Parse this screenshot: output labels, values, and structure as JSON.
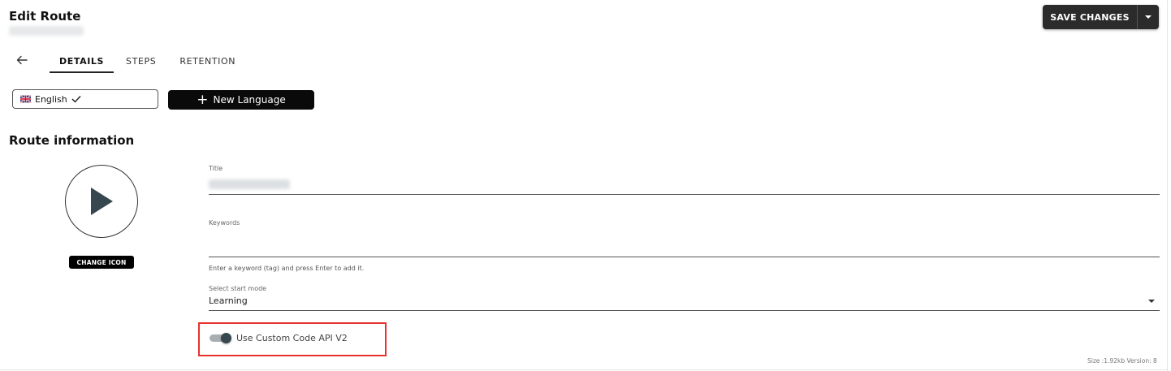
{
  "header": {
    "title": "Edit Route",
    "save_label": "SAVE CHANGES",
    "save_dropdown_icon": "caret-down-icon"
  },
  "nav": {
    "back_icon": "arrow-left-icon",
    "tabs": [
      {
        "label": "DETAILS",
        "active": true
      },
      {
        "label": "STEPS",
        "active": false
      },
      {
        "label": "RETENTION",
        "active": false
      }
    ]
  },
  "languages": {
    "current": "English",
    "current_flag_icon": "uk-flag-icon",
    "current_check_icon": "check-icon",
    "new_label": "New Language",
    "new_icon": "plus-icon"
  },
  "route_info": {
    "section_title": "Route information",
    "icon": "play-icon",
    "change_icon_label": "CHANGE ICON",
    "title_label": "Title",
    "keywords_label": "Keywords",
    "keywords_helper": "Enter a keyword (tag) and press Enter to add it.",
    "start_mode_label": "Select start mode",
    "start_mode_value": "Learning",
    "custom_code_label": "Use Custom Code API V2",
    "custom_code_enabled": true
  },
  "footer": {
    "info": "Size :1.92kb Version: 8"
  },
  "colors": {
    "highlight": "#e8322e",
    "toggle_thumb": "#37474f",
    "toggle_track": "#a9aeb2",
    "primary_dark": "#2b2b2b"
  }
}
